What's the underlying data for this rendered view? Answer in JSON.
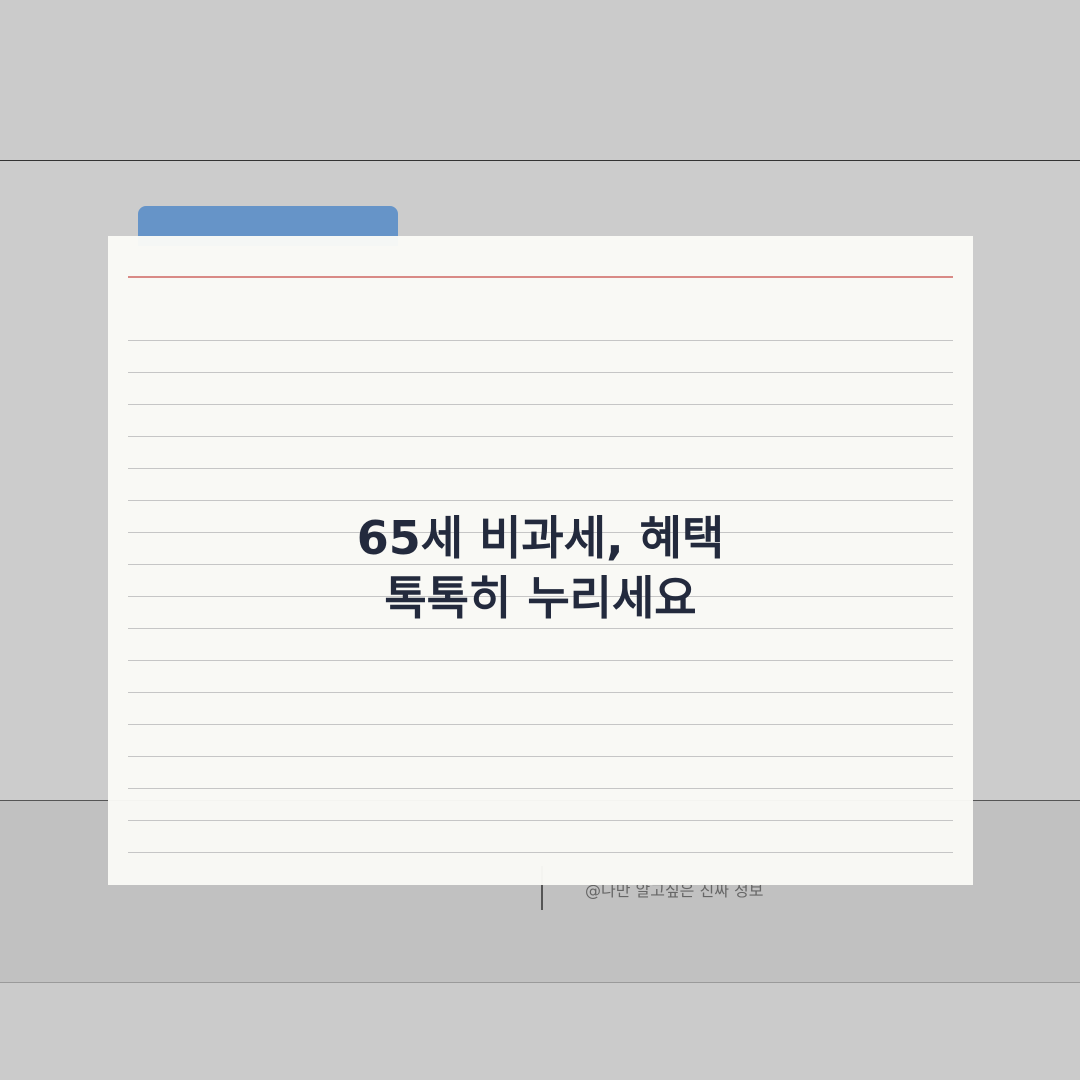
{
  "card": {
    "title_line_1": "65세 비과세, 혜택",
    "title_line_2": "톡톡히 누리세요"
  },
  "footer": {
    "text": "@나만 알고싶은 진짜 정보"
  },
  "colors": {
    "background": "#cbcbcb",
    "tab": "#6694c8",
    "card": "#fafaf6",
    "margin_line": "#d98a86",
    "title_text": "#232a3d"
  }
}
